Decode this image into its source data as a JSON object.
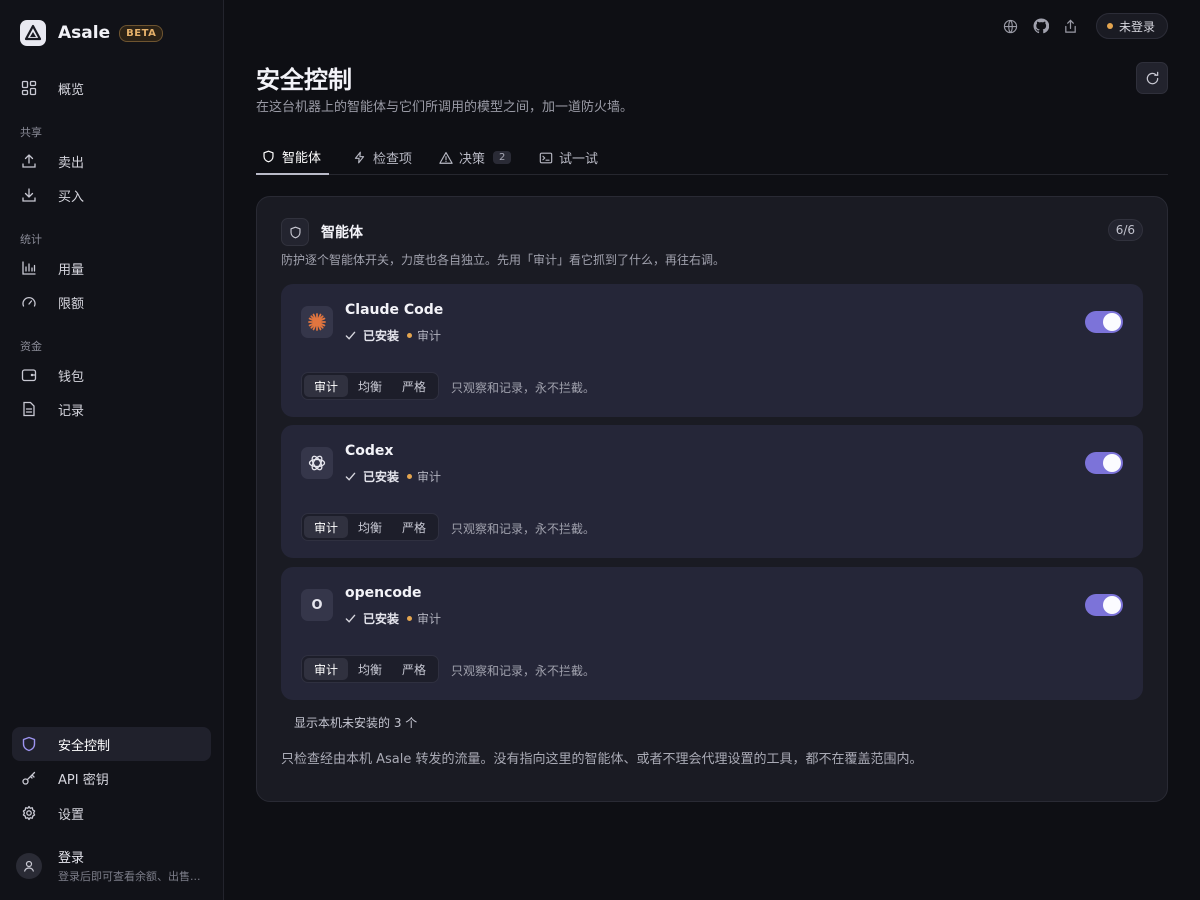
{
  "brand": {
    "name": "Asale",
    "badge": "BETA"
  },
  "sidebar": {
    "overview": "概览",
    "groups": {
      "share": "共享",
      "stats": "统计",
      "funds": "资金"
    },
    "items": {
      "sell": "卖出",
      "buy": "买入",
      "usage": "用量",
      "quota": "限额",
      "wallet": "钱包",
      "records": "记录",
      "security": "安全控制",
      "api_keys": "API 密钥",
      "settings": "设置"
    },
    "account": {
      "name": "登录",
      "hint": "登录后即可查看余额、出售..."
    }
  },
  "topbar": {
    "login_status": "未登录"
  },
  "page": {
    "title": "安全控制",
    "subtitle": "在这台机器上的智能体与它们所调用的模型之间，加一道防火墙。"
  },
  "tabs": [
    {
      "label": "智能体",
      "icon": "shield-icon"
    },
    {
      "label": "检查项",
      "icon": "lightning-icon"
    },
    {
      "label": "决策",
      "icon": "warning-icon",
      "count": "2"
    },
    {
      "label": "试一试",
      "icon": "terminal-icon"
    }
  ],
  "panel": {
    "title": "智能体",
    "count": "6/6",
    "description": "防护逐个智能体开关，力度也各自独立。先用「审计」看它抓到了什么，再往右调。",
    "show_more": "显示本机未安装的 3 个",
    "footnote": "只检查经由本机 Asale 转发的流量。没有指向这里的智能体、或者不理会代理设置的工具，都不在覆盖范围内。"
  },
  "agents": [
    {
      "name": "Claude Code",
      "icon": "claude-logo-icon",
      "status": "已安装",
      "mode": "审计",
      "enabled": true,
      "levels": [
        "审计",
        "均衡",
        "严格"
      ],
      "level_desc": "只观察和记录，永不拦截。"
    },
    {
      "name": "Codex",
      "icon": "openai-logo-icon",
      "status": "已安装",
      "mode": "审计",
      "enabled": true,
      "levels": [
        "审计",
        "均衡",
        "严格"
      ],
      "level_desc": "只观察和记录，永不拦截。"
    },
    {
      "name": "opencode",
      "icon_letter": "O",
      "status": "已安装",
      "mode": "审计",
      "enabled": true,
      "levels": [
        "审计",
        "均衡",
        "严格"
      ],
      "level_desc": "只观察和记录，永不拦截。"
    }
  ],
  "colors": {
    "accent": "#7c73d9",
    "status_dot": "#e4a54f",
    "beta": "#e4b06a"
  }
}
